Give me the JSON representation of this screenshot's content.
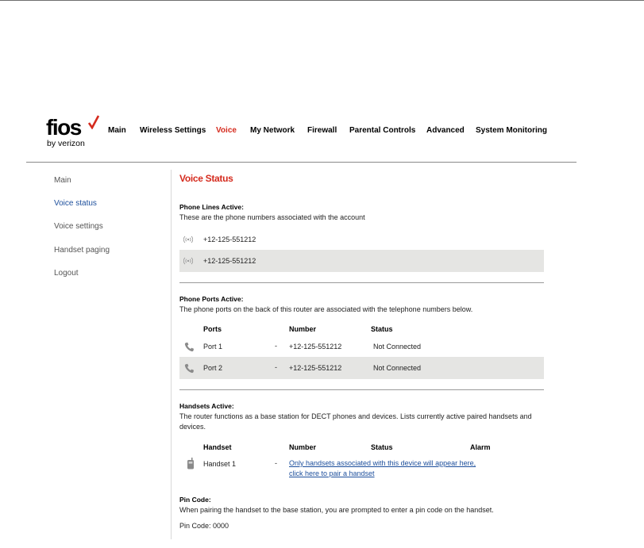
{
  "brand": {
    "name": "fios",
    "sub": "by verizon",
    "accent": "#d52b1e"
  },
  "topnav": {
    "items": [
      {
        "label": "Main",
        "active": false
      },
      {
        "label": "Wireless Settings",
        "active": false
      },
      {
        "label": "Voice",
        "active": true
      },
      {
        "label": "My Network",
        "active": false
      },
      {
        "label": "Firewall",
        "active": false
      },
      {
        "label": "Parental Controls",
        "active": false
      },
      {
        "label": "Advanced",
        "active": false
      },
      {
        "label": "System Monitoring",
        "active": false
      }
    ]
  },
  "sidebar": {
    "items": [
      {
        "label": "Main",
        "active": false
      },
      {
        "label": "Voice status",
        "active": true
      },
      {
        "label": "Voice settings",
        "active": false
      },
      {
        "label": "Handset paging",
        "active": false
      },
      {
        "label": "Logout",
        "active": false
      }
    ]
  },
  "page": {
    "title": "Voice Status"
  },
  "phone_lines": {
    "title": "Phone Lines Active:",
    "desc": "These are the phone numbers associated with the account",
    "lines": [
      {
        "icon": "signal-icon",
        "number": "+12-125-551212"
      },
      {
        "icon": "signal-icon",
        "number": "+12-125-551212"
      }
    ]
  },
  "phone_ports": {
    "title": "Phone Ports Active:",
    "desc": "The phone ports on the back of this router are associated with the telephone numbers below.",
    "headers": {
      "ports": "Ports",
      "number": "Number",
      "status": "Status"
    },
    "rows": [
      {
        "icon": "phone-icon",
        "port": "Port 1",
        "dash": "-",
        "number": "+12-125-551212",
        "status": "Not Connected"
      },
      {
        "icon": "phone-icon",
        "port": "Port 2",
        "dash": "-",
        "number": "+12-125-551212",
        "status": "Not Connected"
      }
    ]
  },
  "handsets": {
    "title": "Handsets Active:",
    "desc": "The router functions as a base station for DECT phones and devices. Lists currently active paired handsets and devices.",
    "headers": {
      "handset": "Handset",
      "number": "Number",
      "status": "Status",
      "alarm": "Alarm"
    },
    "rows": [
      {
        "icon": "handset-icon",
        "name": "Handset 1",
        "dash": "-",
        "link": "Only handsets associated with this device will appear here, click here to pair a handset"
      }
    ]
  },
  "pin": {
    "title": "Pin Code:",
    "desc": "When pairing the handset to the base station, you are prompted to enter a pin code on the handset.",
    "value": "Pin Code: 0000"
  }
}
